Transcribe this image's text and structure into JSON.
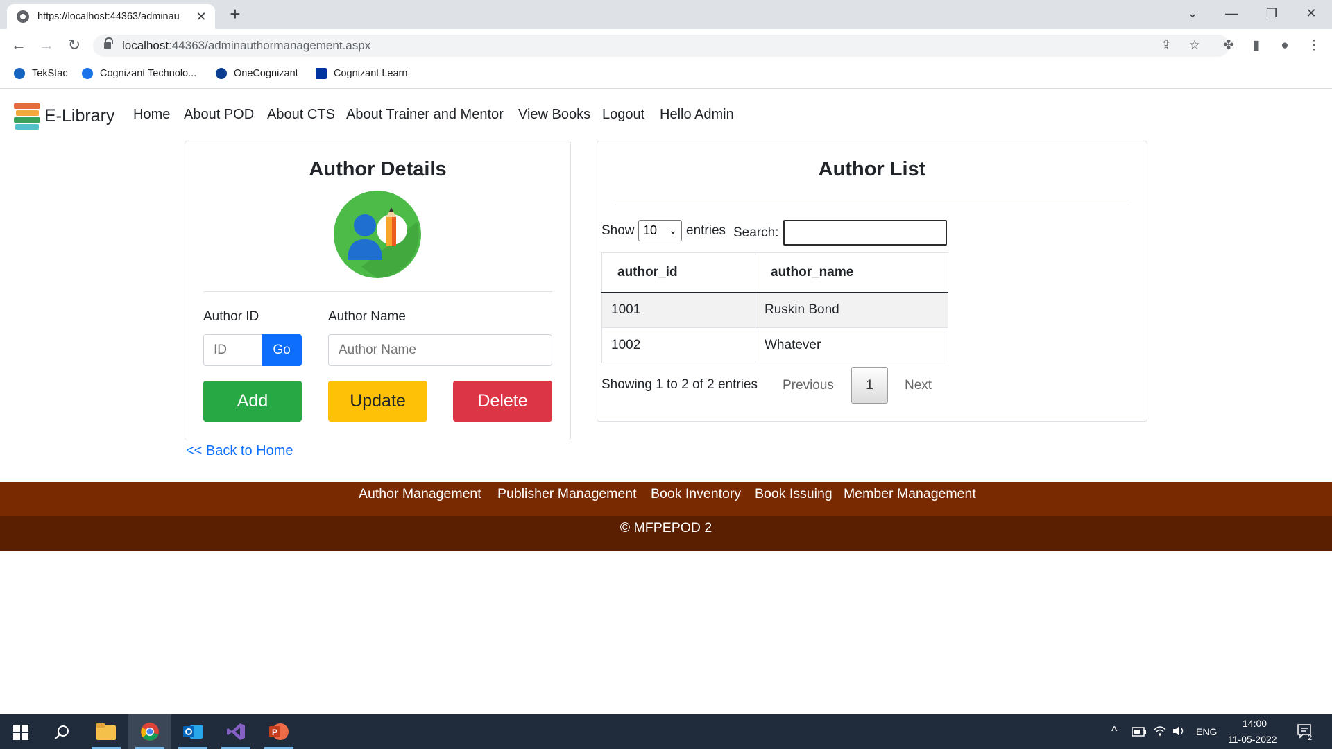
{
  "browser": {
    "tab_title": "https://localhost:44363/adminau",
    "url_host": "localhost",
    "url_path": ":44363/adminauthormanagement.aspx",
    "bookmarks": [
      "TekStac",
      "Cognizant Technolo...",
      "OneCognizant",
      "Cognizant Learn"
    ]
  },
  "site": {
    "brand": "E-Library",
    "nav": [
      "Home",
      "About POD",
      "About CTS",
      "About Trainer and Mentor",
      "View Books",
      "Logout",
      "Hello Admin"
    ]
  },
  "details": {
    "title": "Author Details",
    "author_id_label": "Author ID",
    "author_name_label": "Author Name",
    "id_placeholder": "ID",
    "name_placeholder": "Author Name",
    "go": "Go",
    "add": "Add",
    "update": "Update",
    "delete": "Delete",
    "back": "<< Back to Home"
  },
  "list": {
    "title": "Author List",
    "show": "Show",
    "entries_value": "10",
    "entries": "entries",
    "search": "Search:",
    "columns": [
      "author_id",
      "author_name"
    ],
    "rows": [
      [
        "1001",
        "Ruskin Bond"
      ],
      [
        "1002",
        "Whatever"
      ]
    ],
    "info": "Showing 1 to 2 of 2 entries",
    "previous": "Previous",
    "page": "1",
    "next": "Next"
  },
  "footer": {
    "links": [
      "Author Management",
      "Publisher Management",
      "Book Inventory",
      "Book Issuing",
      "Member Management"
    ],
    "copyright": "© MFPEPOD 2"
  },
  "taskbar": {
    "lang": "ENG",
    "time": "14:00",
    "date": "11-05-2022",
    "notifications": "2"
  },
  "colors": {
    "primary": "#0d6efd",
    "success": "#28a745",
    "warning": "#ffc107",
    "danger": "#dc3545",
    "footer_top": "#7a2a00",
    "footer_bottom": "#5a1f00"
  }
}
